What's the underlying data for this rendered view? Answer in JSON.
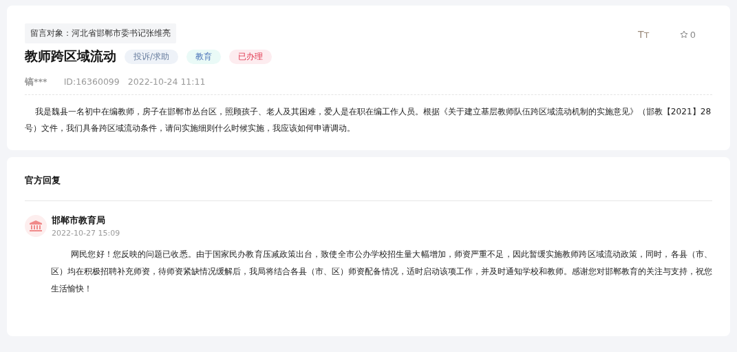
{
  "message": {
    "target": "留言对象：河北省邯郸市委书记张维亮",
    "title": "教师跨区域流动",
    "tags": [
      {
        "label": "投诉/求助",
        "kind": "type"
      },
      {
        "label": "教育",
        "kind": "field"
      },
      {
        "label": "已办理",
        "kind": "status"
      }
    ],
    "font_size_label": "Tт",
    "favorite_count": "0",
    "author": "镐***",
    "id": "ID:16360099",
    "time": "2022-10-24 11:11",
    "body": "我是魏县一名初中在编教师，房子在邯郸市丛台区，照顾孩子、老人及其困难，爱人是在职在编工作人员。根据《关于建立基层教师队伍跨区域流动机制的实施意见》（邯教【2021】28号）文件，我们具备跨区域流动条件，请问实施细则什么时候实施，我应该如何申请调动。"
  },
  "reply": {
    "heading": "官方回复",
    "department": "邯郸市教育局",
    "time": "2022-10-27 15:09",
    "body": "网民您好！您反映的问题已收悉。由于国家民办教育压减政策出台，致使全市公办学校招生量大幅增加，师资严重不足，因此暂缓实施教师跨区域流动政策，同时，各县（市、区）均在积极招聘补充师资，待师资紧缺情况缓解后，我局将结合各县（市、区）师资配备情况，适时启动该项工作，并及时通知学校和教师。感谢您对邯郸教育的关注与支持，祝您生活愉快！"
  }
}
